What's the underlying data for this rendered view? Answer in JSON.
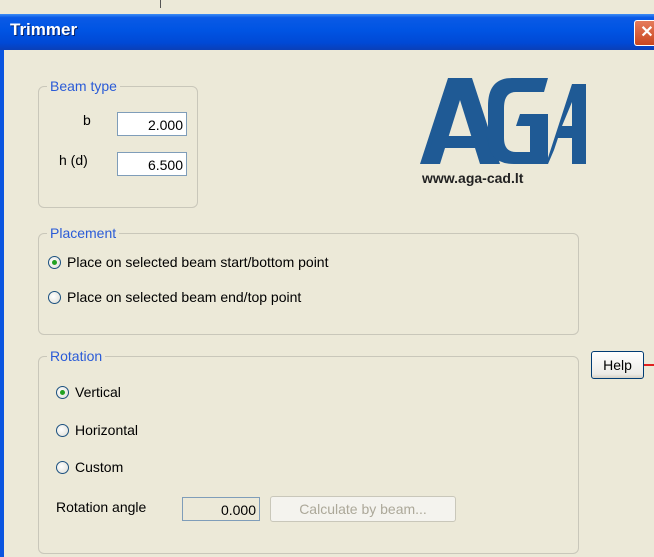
{
  "window": {
    "title": "Trimmer",
    "close_glyph": "✕"
  },
  "logo": {
    "mark": "AGA",
    "url": "www.aga-cad.lt",
    "brand_color": "#1f5a95"
  },
  "beam_type": {
    "label": "Beam type",
    "b_label": "b",
    "b_value": "2.000",
    "h_label": "h (d)",
    "h_value": "6.500"
  },
  "placement": {
    "label": "Placement",
    "options": [
      {
        "label": "Place on selected beam start/bottom point",
        "checked": true
      },
      {
        "label": "Place on selected beam end/top point",
        "checked": false
      }
    ]
  },
  "rotation": {
    "label": "Rotation",
    "options": [
      {
        "label": "Vertical",
        "checked": true
      },
      {
        "label": "Horizontal",
        "checked": false
      },
      {
        "label": "Custom",
        "checked": false
      }
    ],
    "angle_label": "Rotation angle",
    "angle_value": "0.000",
    "calc_button": "Calculate by beam..."
  },
  "help_button": "Help"
}
